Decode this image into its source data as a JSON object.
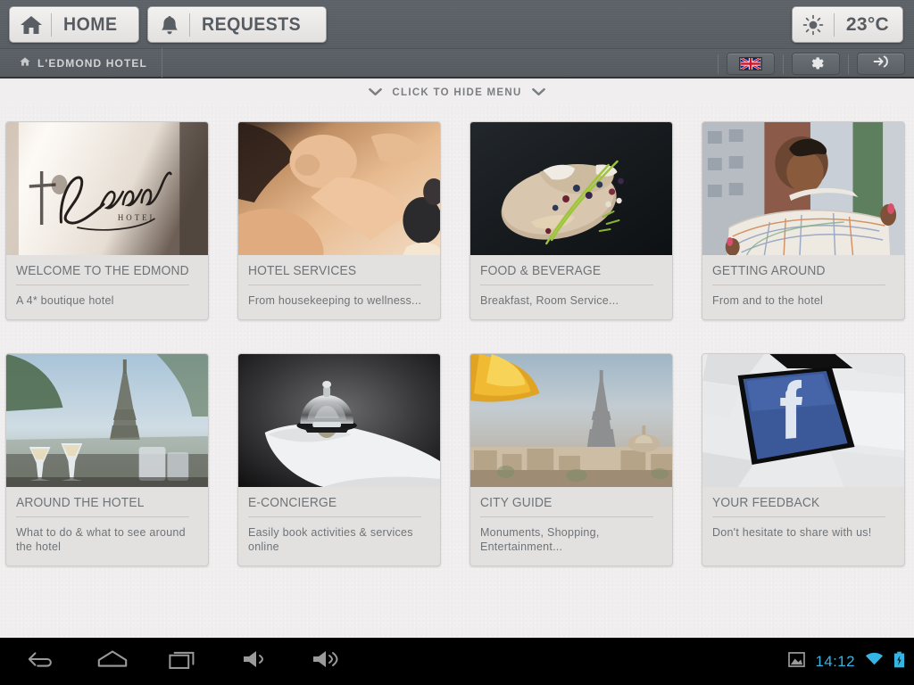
{
  "header": {
    "nav_buttons": [
      {
        "label": "HOME",
        "icon": "home-icon"
      },
      {
        "label": "REQUESTS",
        "icon": "bell-icon"
      }
    ],
    "weather": {
      "icon": "sun-icon",
      "temperature": "23°C"
    }
  },
  "breadcrumb": {
    "icon": "home-icon",
    "label": "L'EDMOND HOTEL"
  },
  "crumb_tools": [
    {
      "name": "language-flag-button",
      "icon": "uk-flag-icon",
      "label": ""
    },
    {
      "name": "settings-button",
      "icon": "gear-icon",
      "label": ""
    },
    {
      "name": "login-button",
      "icon": "login-arrow-icon",
      "label": ""
    }
  ],
  "hide_menu": {
    "label": "CLICK TO HIDE MENU",
    "left_icon": "chevron-down-icon",
    "right_icon": "chevron-down-icon"
  },
  "cards": [
    {
      "title": "WELCOME TO THE EDMOND",
      "description": "A 4* boutique hotel",
      "image": "hotel-logo-on-glass-photo"
    },
    {
      "title": "HOTEL SERVICES",
      "description": "From housekeeping to wellness...",
      "image": "spa-massage-photo"
    },
    {
      "title": "FOOD & BEVERAGE",
      "description": "Breakfast, Room Service...",
      "image": "gourmet-food-plate-photo"
    },
    {
      "title": "GETTING AROUND",
      "description": "From and to the hotel",
      "image": "woman-with-city-map-photo"
    },
    {
      "title": "AROUND THE HOTEL",
      "description": "What to do & what to see around the hotel",
      "image": "eiffel-tower-terrace-photo"
    },
    {
      "title": "E-CONCIERGE",
      "description": "Easily book activities & services online",
      "image": "service-bell-gloved-hand-photo"
    },
    {
      "title": "CITY GUIDE",
      "description": "Monuments, Shopping, Entertainment...",
      "image": "paris-skyline-autumn-photo"
    },
    {
      "title": "YOUR FEEDBACK",
      "description": "Don't hesitate to share with us!",
      "image": "facebook-keyboard-key-photo"
    }
  ],
  "android_bar": {
    "buttons": [
      {
        "name": "back-button",
        "icon": "back-arrow-icon"
      },
      {
        "name": "home-button",
        "icon": "home-outline-icon"
      },
      {
        "name": "recents-button",
        "icon": "recents-icon"
      },
      {
        "name": "volume-down-button",
        "icon": "volume-down-icon"
      },
      {
        "name": "volume-up-button",
        "icon": "volume-up-icon"
      }
    ],
    "status": {
      "screenshot_icon": "screenshot-icon",
      "time": "14:12",
      "wifi_icon": "wifi-icon",
      "battery_icon": "battery-charging-icon"
    }
  },
  "colors": {
    "header_gray": "#575d62",
    "page_bg": "#f0eeee",
    "card_bg": "#e3e1e0",
    "text_gray": "#6e7377",
    "android_accent": "#33b5e5",
    "facebook_blue": "#3b5998"
  }
}
